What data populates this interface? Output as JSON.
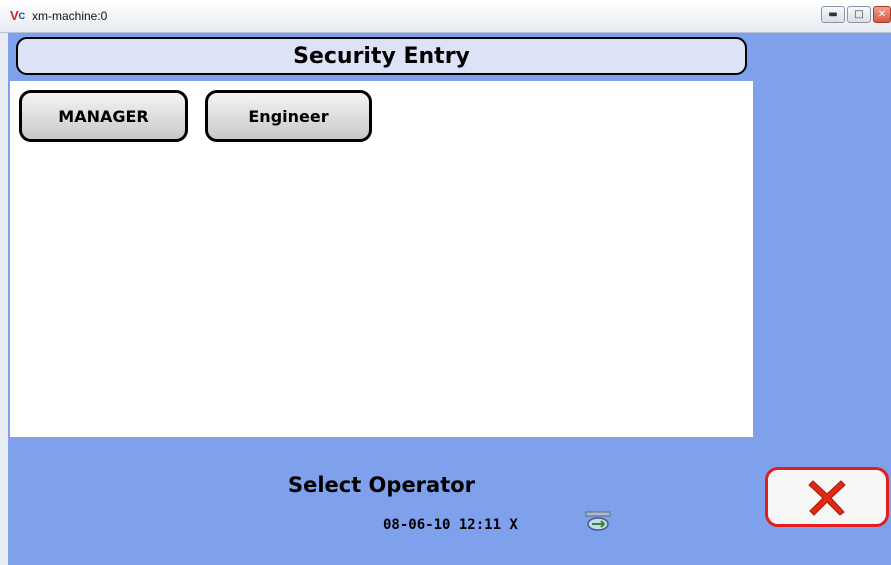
{
  "window": {
    "app_icon": "V",
    "app_icon_sub": "C",
    "title": "xm-machine:0",
    "controls": [
      "minimize-icon",
      "maximize-icon",
      "close-icon"
    ]
  },
  "header": {
    "title": "Security Entry"
  },
  "operators": [
    {
      "label": "MANAGER"
    },
    {
      "label": "Engineer"
    }
  ],
  "prompt": "Select Operator",
  "cancel": {
    "icon": "close-x-icon",
    "color": "#e02a14"
  },
  "status": {
    "datetime": "08-06-10 12:11 X",
    "icon": "network-icon"
  },
  "colors": {
    "background": "#7fa0ea",
    "header_fill": "#dde3f7",
    "panel": "#ffffff",
    "cancel_border": "#e21d1d"
  }
}
